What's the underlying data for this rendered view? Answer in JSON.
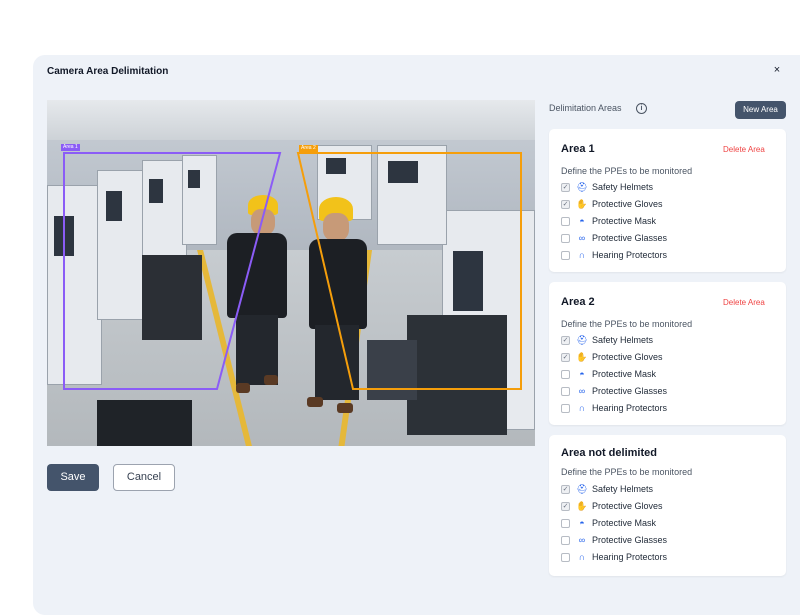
{
  "dialog": {
    "title": "Camera Area Delimitation",
    "close_label": "×"
  },
  "camera": {
    "areas": [
      {
        "tag": "Area 1",
        "color": "#8b5cf6"
      },
      {
        "tag": "Area 2",
        "color": "#f59e0b"
      }
    ]
  },
  "actions": {
    "save_label": "Save",
    "cancel_label": "Cancel"
  },
  "panel": {
    "header": "Delimitation Areas",
    "info_icon": "i",
    "new_area_label": "New Area"
  },
  "cards": [
    {
      "title": "Area 1",
      "delete_label": "Delete Area",
      "subtitle": "Define the PPEs to be monitored",
      "ppes": [
        {
          "label": "Safety Helmets",
          "icon": "helmet-icon",
          "glyph": "⛑",
          "checked": true
        },
        {
          "label": "Protective Gloves",
          "icon": "glove-icon",
          "glyph": "✋",
          "checked": true
        },
        {
          "label": "Protective Mask",
          "icon": "mask-icon",
          "glyph": "◓",
          "checked": false
        },
        {
          "label": "Protective Glasses",
          "icon": "glasses-icon",
          "glyph": "∞",
          "checked": false
        },
        {
          "label": "Hearing Protectors",
          "icon": "headphones-icon",
          "glyph": "∩",
          "checked": false
        }
      ]
    },
    {
      "title": "Area 2",
      "delete_label": "Delete Area",
      "subtitle": "Define the PPEs to be monitored",
      "ppes": [
        {
          "label": "Safety Helmets",
          "icon": "helmet-icon",
          "glyph": "⛑",
          "checked": true
        },
        {
          "label": "Protective Gloves",
          "icon": "glove-icon",
          "glyph": "✋",
          "checked": true
        },
        {
          "label": "Protective Mask",
          "icon": "mask-icon",
          "glyph": "◓",
          "checked": false
        },
        {
          "label": "Protective Glasses",
          "icon": "glasses-icon",
          "glyph": "∞",
          "checked": false
        },
        {
          "label": "Hearing Protectors",
          "icon": "headphones-icon",
          "glyph": "∩",
          "checked": false
        }
      ]
    },
    {
      "title": "Area not delimited",
      "subtitle": "Define the PPEs to be monitored",
      "ppes": [
        {
          "label": "Safety Helmets",
          "icon": "helmet-icon",
          "glyph": "⛑",
          "checked": true
        },
        {
          "label": "Protective Gloves",
          "icon": "glove-icon",
          "glyph": "✋",
          "checked": true
        },
        {
          "label": "Protective Mask",
          "icon": "mask-icon",
          "glyph": "◓",
          "checked": false
        },
        {
          "label": "Protective Glasses",
          "icon": "glasses-icon",
          "glyph": "∞",
          "checked": false
        },
        {
          "label": "Hearing Protectors",
          "icon": "headphones-icon",
          "glyph": "∩",
          "checked": false
        }
      ]
    }
  ]
}
